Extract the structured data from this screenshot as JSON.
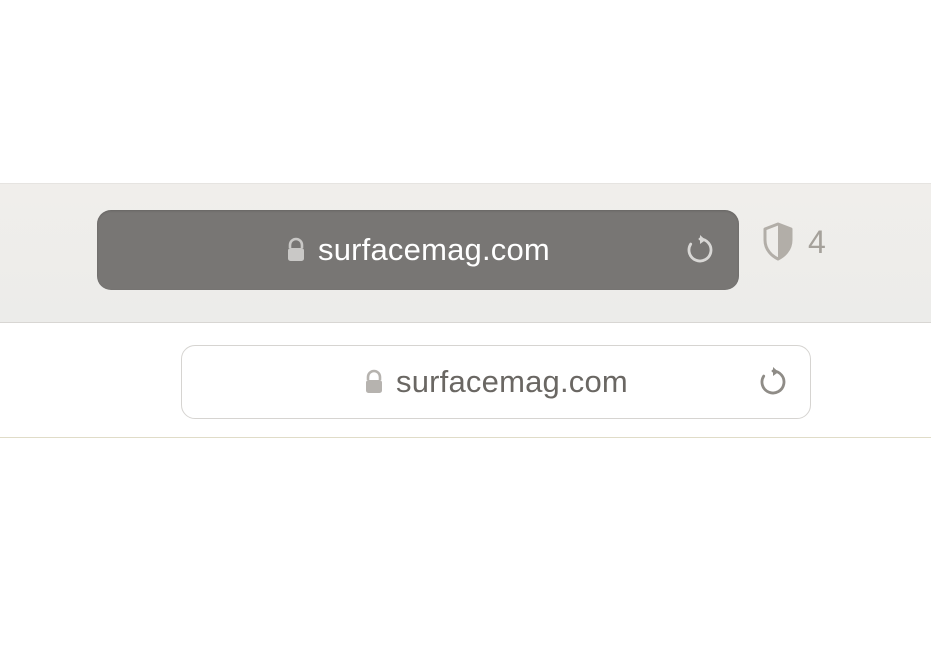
{
  "toolbar_dark": {
    "domain": "surfacemag.com",
    "lock_color": "#c9c8c6",
    "text_color": "#ffffff",
    "reload_color": "#d8d7d5",
    "pill_bg": "#787674"
  },
  "privacy": {
    "tracker_count": "4",
    "shield_color": "#b2aea8",
    "count_color": "#a5a19b"
  },
  "toolbar_light": {
    "domain": "surfacemag.com",
    "lock_color": "#b6b3af",
    "text_color": "#6a6763",
    "reload_color": "#8f8c87",
    "border_color": "#d6d4d1"
  }
}
